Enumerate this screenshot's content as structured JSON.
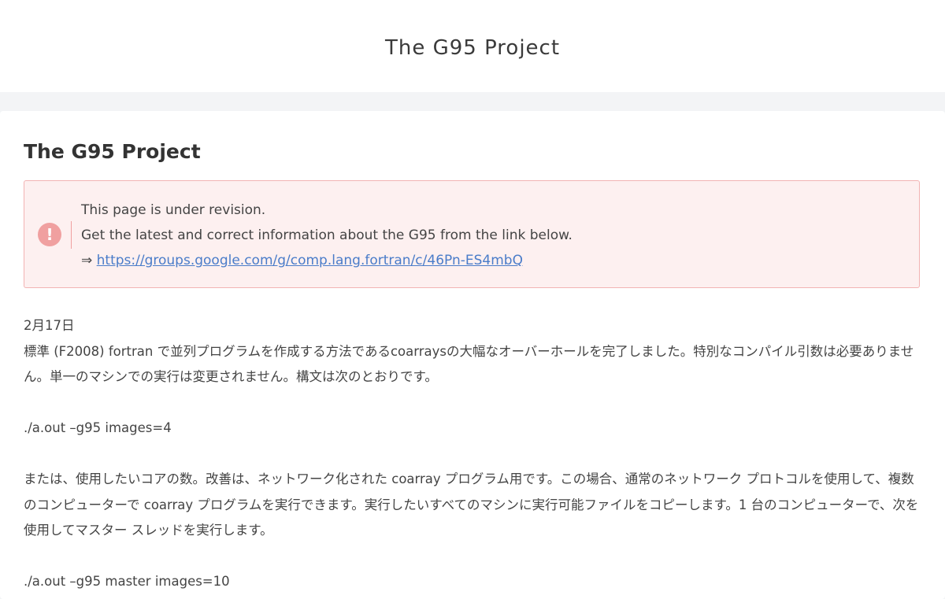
{
  "header": {
    "site_title": "The G95 Project"
  },
  "article": {
    "title": "The G95 Project",
    "notice": {
      "icon": "exclamation-icon",
      "line1": "This page is under revision.",
      "line2": "Get the latest and correct information about the G95 from the link below.",
      "arrow": "⇒",
      "link_text": "https://groups.google.com/g/comp.lang.fortran/c/46Pn-ES4mbQ"
    },
    "date": "2月17日",
    "para1": "標準 (F2008) fortran で並列プログラムを作成する方法であるcoarraysの大幅なオーバーホールを完了しました。特別なコンパイル引数は必要ありません。単一のマシンでの実行は変更されません。構文は次のとおりです。",
    "cmd1": "./a.out –g95 images=4",
    "para2": "または、使用したいコアの数。改善は、ネットワーク化された coarray プログラム用です。この場合、通常のネットワーク プロトコルを使用して、複数のコンピューターで coarray プログラムを実行できます。実行したいすべてのマシンに実行可能ファイルをコピーします。1 台のコンピューターで、次を使用してマスター スレッドを実行します。",
    "cmd2": "./a.out –g95 master images=10"
  },
  "colors": {
    "notice_bg": "#fdf0f0",
    "notice_border": "#f2b3b3",
    "notice_icon": "#f0a0a0",
    "link": "#4a7cc9",
    "page_bg": "#f3f4f6"
  }
}
